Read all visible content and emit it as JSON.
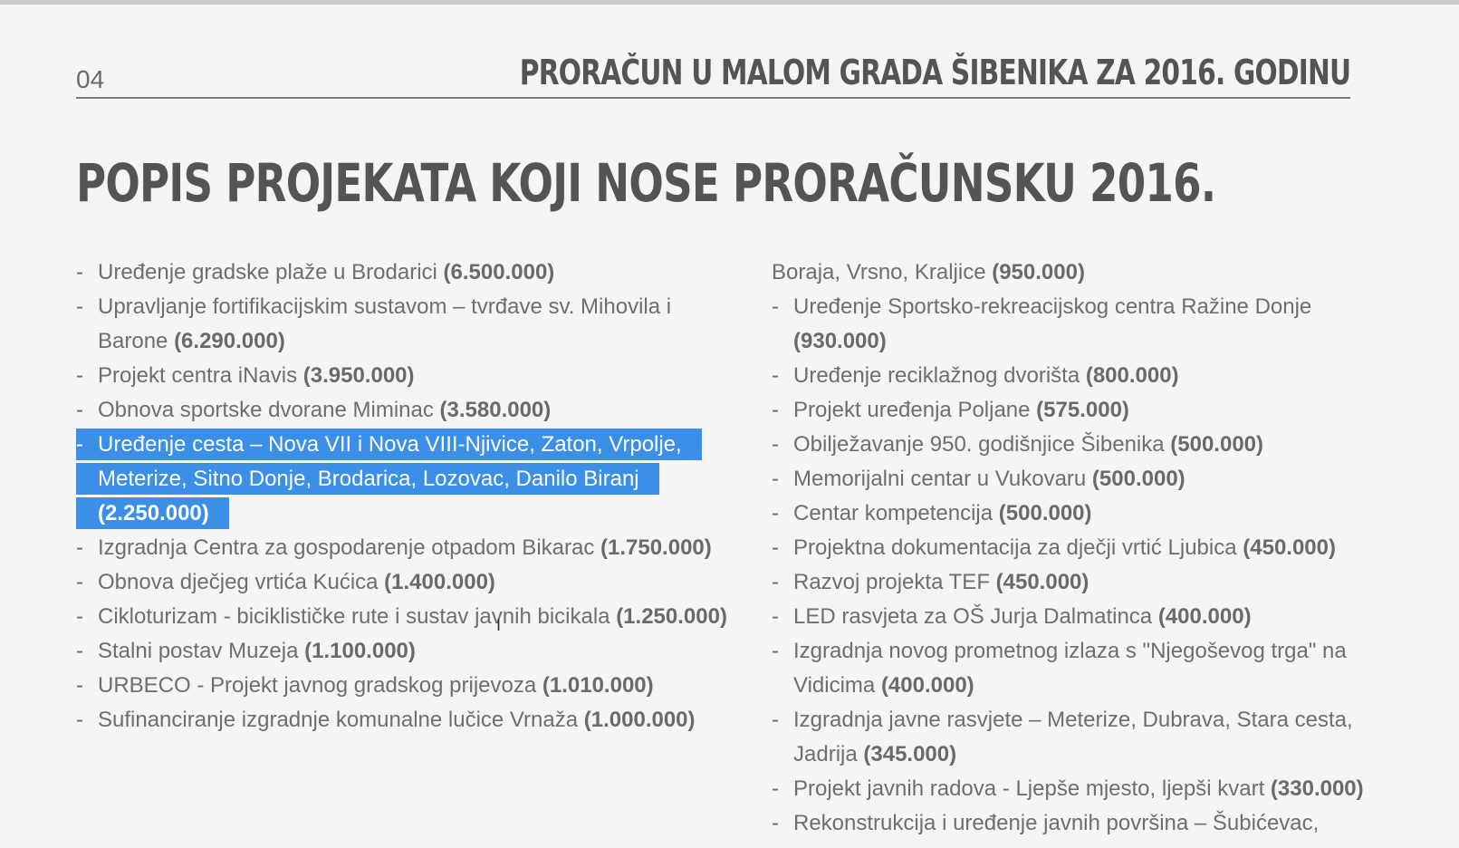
{
  "page": {
    "number": "04",
    "running_title": "PRORAČUN U MALOM GRADA ŠIBENIKA ZA 2016. GODINU",
    "heading": "POPIS PROJEKATA KOJI NOSE PRORAČUNSKU 2016."
  },
  "left_items": [
    {
      "text": "Uređenje gradske plaže u Brodarici ",
      "amount": "(6.500.000)"
    },
    {
      "text": "Upravljanje fortifikacijskim sustavom – tvrđave sv. Mihovila i Barone ",
      "amount": "(6.290.000)"
    },
    {
      "text": "Projekt centra iNavis ",
      "amount": "(3.950.000)"
    },
    {
      "text": "Obnova sportske dvorane Miminac ",
      "amount": "(3.580.000)"
    },
    {
      "text": "Uređenje cesta – Nova VII i Nova VIII-Njivice, Zaton, Vrpolje, Meterize, Sitno Donje, Brodarica, Lozovac, Danilo Biranj ",
      "amount": "(2.250.000)"
    },
    {
      "text": "Izgradnja Centra za gospodarenje otpadom Bikarac ",
      "amount": "(1.750.000)"
    },
    {
      "text": "Obnova dječjeg vrtića Kućica ",
      "amount": "(1.400.000)"
    },
    {
      "text": "Cikloturizam - biciklističke rute i sustav javnih bicikala ",
      "amount": "(1.250.000)"
    },
    {
      "text": "Stalni postav Muzeja ",
      "amount": "(1.100.000)"
    },
    {
      "text": "URBECO - Projekt javnog gradskog prijevoza ",
      "amount": "(1.010.000)"
    },
    {
      "text": "Sufinanciranje izgradnje komunalne lučice Vrnaža ",
      "amount": "(1.000.000)"
    }
  ],
  "right_continuation": {
    "text": "Boraja, Vrsno, Kraljice ",
    "amount": "(950.000)"
  },
  "right_items": [
    {
      "text": "Uređenje Sportsko-rekreacijskog centra Ražine Donje ",
      "amount": "(930.000)"
    },
    {
      "text": "Uređenje reciklažnog dvorišta ",
      "amount": "(800.000)"
    },
    {
      "text": "Projekt uređenja Poljane ",
      "amount": "(575.000)"
    },
    {
      "text": "Obilježavanje 950. godišnjice Šibenika ",
      "amount": "(500.000)"
    },
    {
      "text": "Memorijalni centar u Vukovaru ",
      "amount": "(500.000)"
    },
    {
      "text": "Centar kompetencija ",
      "amount": "(500.000)"
    },
    {
      "text": "Projektna dokumentacija za dječji vrtić Ljubica ",
      "amount": "(450.000)"
    },
    {
      "text": "Razvoj projekta TEF ",
      "amount": "(450.000)"
    },
    {
      "text": "LED rasvjeta za OŠ Jurja Dalmatinca ",
      "amount": "(400.000)"
    },
    {
      "text": "Izgradnja novog prometnog izlaza s \"Njegoševog trga\" na Vidicima ",
      "amount": "(400.000)"
    },
    {
      "text": "Izgradnja javne rasvjete – Meterize, Dubrava, Stara cesta, Jadrija ",
      "amount": "(345.000)"
    },
    {
      "text": "Projekt javnih radova - Ljepše mjesto, ljepši kvart ",
      "amount": "(330.000)"
    },
    {
      "text": "Rekonstrukcija i uređenje javnih površina – Šubićevac,",
      "amount": ""
    }
  ],
  "colors": {
    "selection": "#3b8fe6",
    "text": "#6e6e6e",
    "heading": "#545454"
  },
  "icons": {
    "cursor": "text-cursor-icon"
  }
}
